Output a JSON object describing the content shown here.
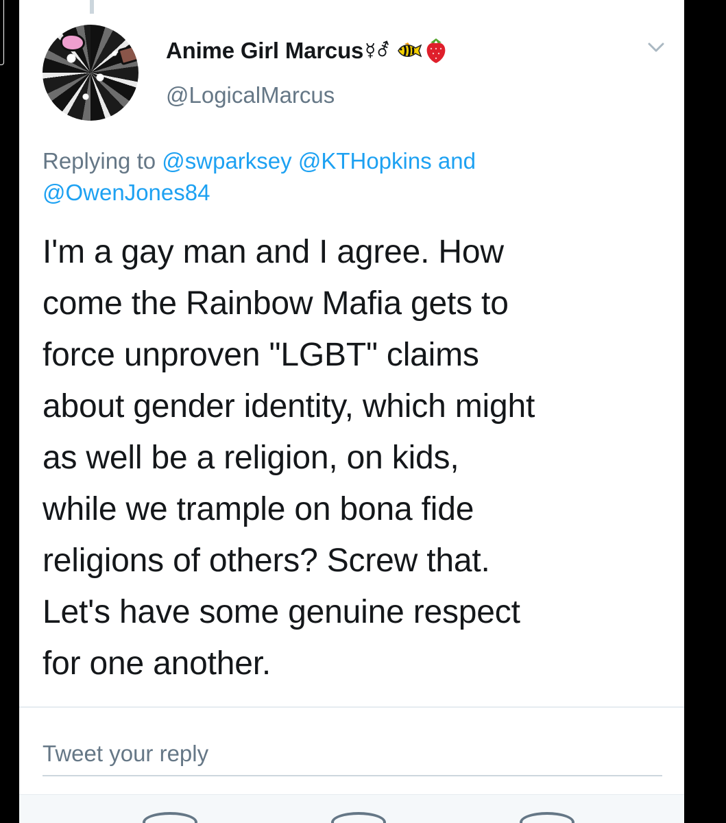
{
  "tweet": {
    "display_name": "Anime Girl Marcus",
    "identity_symbols": "☿⚦",
    "handle": "@LogicalMarcus",
    "replying_prefix": "Replying to ",
    "mentions": [
      "@swparksey",
      "@KTHopkins",
      "@OwenJones84"
    ],
    "mention_joiner": " and",
    "text": "I'm a gay man and I agree. How\ncome the Rainbow Mafia gets to\nforce unproven \"LGBT\" claims\nabout gender identity, which might\nas well be a religion, on kids,\nwhile we trample on bona fide\nreligions of others? Screw that.\nLet's have some genuine respect\nfor one another."
  },
  "reply": {
    "placeholder": "Tweet your reply"
  },
  "icons": {
    "avatar": "avatar-profile-image",
    "name_emojis": [
      "tropical-fish-icon",
      "strawberry-icon"
    ],
    "menu": "chevron-down-icon"
  },
  "colors": {
    "text": "#14171a",
    "secondary": "#657786",
    "link": "#1da1f2",
    "divider": "#e6ecf0",
    "background": "#ffffff"
  }
}
